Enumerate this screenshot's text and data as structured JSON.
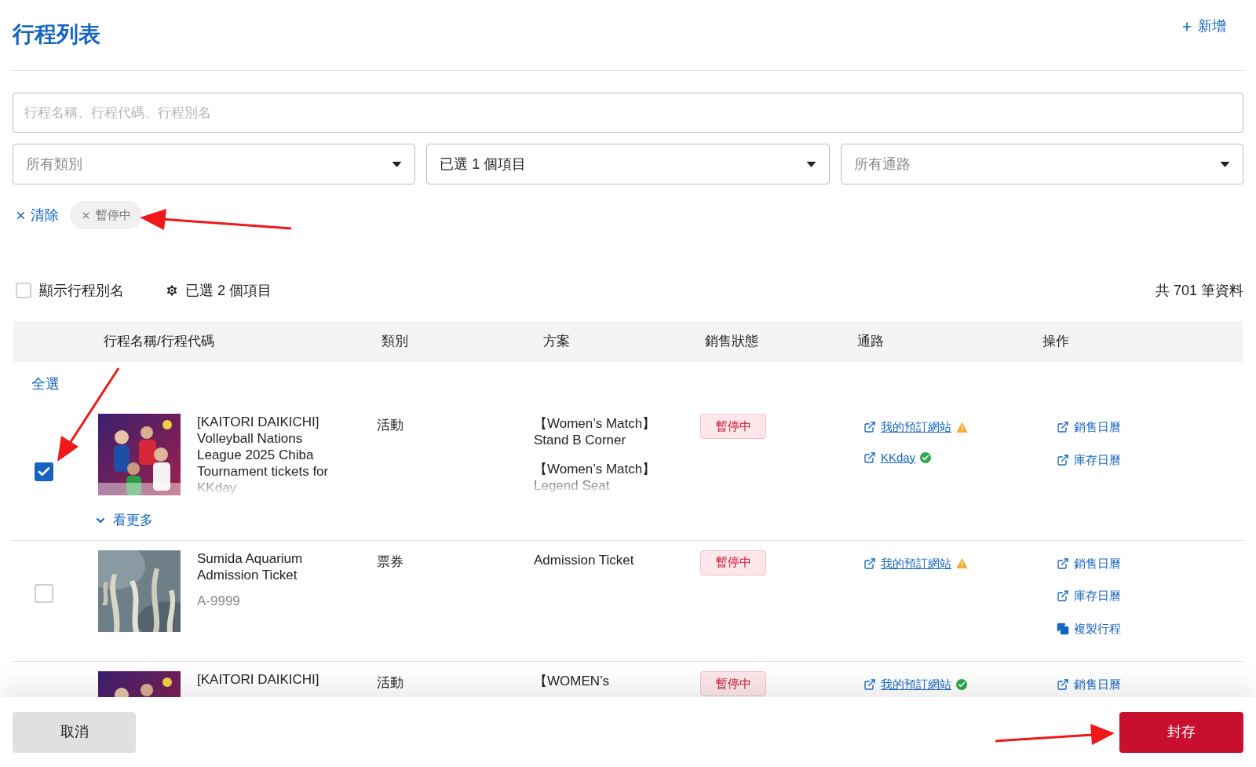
{
  "page_title": "行程列表",
  "add_button": "新增",
  "search": {
    "placeholder": "行程名稱、行程代碼、行程別名"
  },
  "filters": [
    {
      "placeholder": "所有類別"
    },
    {
      "value": "已選 1 個項目"
    },
    {
      "placeholder": "所有通路"
    }
  ],
  "clear_link": "清除",
  "active_chips": [
    "暫停中"
  ],
  "show_alias": {
    "label": "顯示行程別名",
    "checked": false
  },
  "column_settings": "已選 2 個項目",
  "total": "共 701 筆資料",
  "columns": [
    "行程名稱/行程代碼",
    "類別",
    "方案",
    "銷售狀態",
    "通路",
    "操作"
  ],
  "select_all": "全選",
  "rows": [
    {
      "selected": true,
      "name": "[KAITORI DAIKICHI] Volleyball Nations League 2025 Chiba Tournament tickets for KKday",
      "category": "活動",
      "plans": [
        "【Women’s Match】Stand B Corner",
        "【Women’s Match】Legend Seat"
      ],
      "status": "暫停中",
      "channels": [
        {
          "label": "我的預訂網站",
          "kind": "warning"
        },
        {
          "label": "KKday",
          "kind": "ok"
        }
      ],
      "actions": [
        {
          "kind": "open",
          "label": "銷售日曆"
        },
        {
          "kind": "open",
          "label": "庫存日曆"
        }
      ],
      "more": "看更多"
    },
    {
      "selected": false,
      "name": "Sumida Aquarium Admission Ticket",
      "code": "A-9999",
      "category": "票券",
      "plans": [
        "Admission Ticket"
      ],
      "status": "暫停中",
      "channels": [
        {
          "label": "我的預訂網站",
          "kind": "warning"
        }
      ],
      "actions": [
        {
          "kind": "open",
          "label": "銷售日曆"
        },
        {
          "kind": "open",
          "label": "庫存日曆"
        },
        {
          "kind": "copy",
          "label": "複製行程"
        }
      ]
    },
    {
      "name": "[KAITORI DAIKICHI]",
      "category": "活動",
      "plans": [
        "【WOMEN’s"
      ],
      "status": "暫停中",
      "channels": [
        {
          "label": "我的預訂網站",
          "kind": "ok"
        }
      ],
      "actions": [
        {
          "kind": "open",
          "label": "銷售日曆"
        }
      ]
    }
  ],
  "footer": {
    "cancel": "取消",
    "archive": "封存"
  }
}
